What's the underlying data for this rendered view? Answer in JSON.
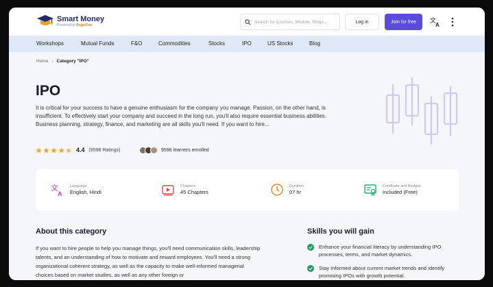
{
  "brand": {
    "name": "Smart Money",
    "tagline_prefix": "Powered by",
    "tagline_brand": "AngelOne"
  },
  "colors": {
    "accent": "#5b4ddb",
    "nav_bg": "#dfe8f7",
    "star": "#f5a623",
    "check": "#1e9e5e",
    "illustration": "#cfc8f3"
  },
  "header": {
    "search_placeholder": "Search for Courses, Module, Blogs...",
    "login_label": "Log in",
    "join_label": "Join for free"
  },
  "nav": {
    "items": [
      "Workshops",
      "Mutual Funds",
      "F&O",
      "Commodities",
      "Stocks",
      "IPO",
      "US Stocks",
      "Blog"
    ]
  },
  "breadcrumb": {
    "home": "Home",
    "current": "Category \"IPO\""
  },
  "page": {
    "title": "IPO",
    "description": "It is critical for your success to have a genuine enthusiasm for the company you manage. Passion, on the other hand, is insufficient. To effectively start your company and succeed in the long run, you'll also require essential business abilities. Business planning, strategy, finance, and marketing are all skills you'll need. If you want to hire...",
    "rating": "4.4",
    "rating_count": "(9598 Ratings)",
    "learners": "9598 learners enrolled"
  },
  "info": {
    "language": {
      "label": "Language",
      "value": "English, Hindi",
      "icon": "translate-icon"
    },
    "chapters": {
      "label": "Chapters",
      "value": "45 Chapters",
      "icon": "play-icon"
    },
    "duration": {
      "label": "Duration",
      "value": "07 hr",
      "icon": "clock-icon"
    },
    "certificate": {
      "label": "Certificate and Badges",
      "value": "Included (Free)",
      "icon": "certificate-icon"
    }
  },
  "about": {
    "title": "About this category",
    "text": "If you want to hire people to help you manage things, you'll need communication skills, leadership talents, and an understanding of how to motivate and reward employees. You'll need a strong organizational coherent strategy, as well as the capacity to make well-informed managerial choices based on market studies, as well as any other foreign or"
  },
  "skills": {
    "title": "Skills you will gain",
    "items": [
      "Enhance your financial literacy by understanding IPO processes, terms, and market dynamics.",
      "Stay informed about current market trends and identify promising IPOs with growth potential."
    ]
  }
}
